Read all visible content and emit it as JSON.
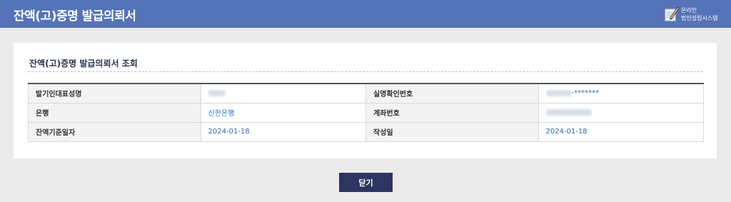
{
  "header": {
    "title": "잔액(고)증명 발급의뢰서",
    "brand_line1": "온라인",
    "brand_line2": "법인설립시스템",
    "brand_icon": "pen-icon"
  },
  "panel": {
    "title": "잔액(고)증명 발급의뢰서 조회"
  },
  "table": {
    "row1": {
      "label_a": "발기인대표성명",
      "value_a": "",
      "label_b": "실명확인번호",
      "value_b_prefix": "",
      "value_b_suffix": "-*******"
    },
    "row2": {
      "label_a": "은행",
      "value_a": "신한은행",
      "label_b": "계좌번호",
      "value_b": ""
    },
    "row3": {
      "label_a": "잔액기준일자",
      "value_a": "2024-01-18",
      "label_b": "작성일",
      "value_b": "2024-01-18"
    }
  },
  "actions": {
    "close_label": "닫기"
  },
  "colors": {
    "header_bg": "#5473b8",
    "value_text": "#2a6cb8",
    "button_bg": "#2c3660"
  }
}
